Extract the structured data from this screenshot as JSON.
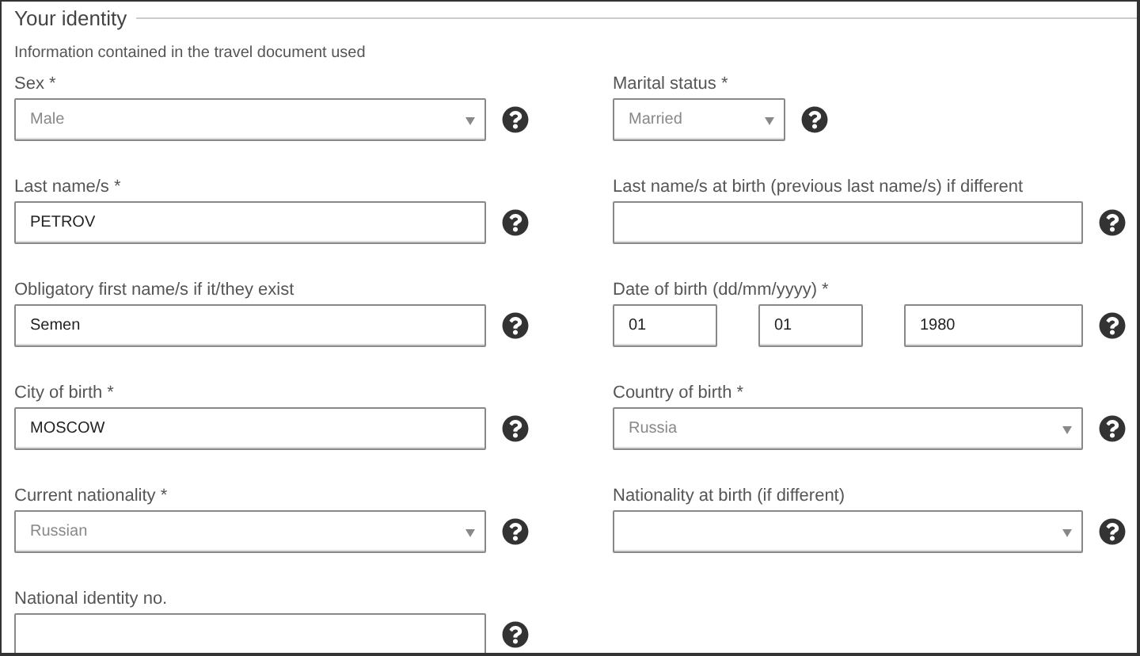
{
  "section": {
    "title": "Your identity",
    "subtitle": "Information contained in the travel document used"
  },
  "fields": [
    {
      "kind": "select",
      "label": "Sex *",
      "value": "Male"
    },
    {
      "kind": "short_select",
      "label": "Marital status *",
      "value": "Married"
    },
    {
      "kind": "text",
      "label": "Last name/s *",
      "value": "PETROV"
    },
    {
      "kind": "text",
      "label": "Last name/s at birth (previous last name/s) if different"
    },
    {
      "kind": "text",
      "label": "Obligatory first name/s if it/they exist",
      "value": "Semen"
    },
    {
      "kind": "date",
      "label": "Date of birth (dd/mm/yyyy) *",
      "parts": [
        "01",
        "01",
        "1980"
      ]
    },
    {
      "kind": "text",
      "label": "City of birth *",
      "value": "MOSCOW"
    },
    {
      "kind": "select",
      "label": "Country of birth *",
      "value": "Russia"
    },
    {
      "kind": "select",
      "label": "Current nationality *",
      "value": "Russian"
    },
    {
      "kind": "select",
      "label": "Nationality at birth (if different)"
    },
    {
      "kind": "text",
      "label": "National identity no."
    }
  ]
}
